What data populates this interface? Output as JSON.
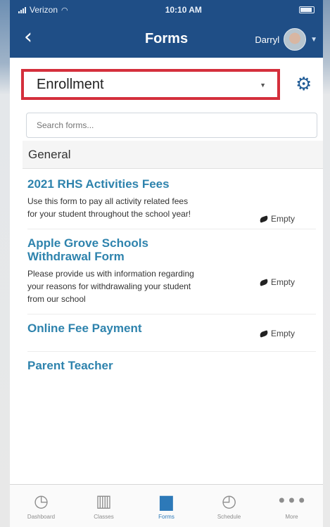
{
  "status_bar": {
    "carrier": "Verizon",
    "time": "10:10 AM",
    "wifi_icon": "wifi-icon",
    "battery_icon": "battery-icon"
  },
  "nav": {
    "title": "Forms",
    "user_name": "Darryl",
    "back_icon": "back-chevron-icon",
    "avatar_icon": "avatar"
  },
  "filter": {
    "selected": "Enrollment",
    "settings_icon": "gear-icon"
  },
  "search": {
    "placeholder": "Search forms..."
  },
  "section": {
    "title": "General"
  },
  "forms": [
    {
      "title": "2021 RHS Activities Fees",
      "description": "Use this form to pay all activity related fees for your student throughout the school year!",
      "status": "Empty"
    },
    {
      "title": "Apple Grove Schools Withdrawal Form",
      "description": "Please provide us with information regarding your reasons for withdrawaling your student from our school",
      "status": "Empty"
    },
    {
      "title": "Online Fee Payment",
      "description": "",
      "status": "Empty"
    },
    {
      "title": "Parent Teacher",
      "description": "",
      "status": ""
    }
  ],
  "tabs": [
    {
      "label": "Dashboard",
      "icon": "dashboard-icon"
    },
    {
      "label": "Classes",
      "icon": "classes-icon"
    },
    {
      "label": "Forms",
      "icon": "forms-icon"
    },
    {
      "label": "Schedule",
      "icon": "schedule-icon"
    },
    {
      "label": "More",
      "icon": "more-icon"
    }
  ],
  "colors": {
    "brand": "#1f4e86",
    "highlight": "#d42f3c",
    "link": "#2e83ad",
    "active_tab": "#2d79b8"
  }
}
